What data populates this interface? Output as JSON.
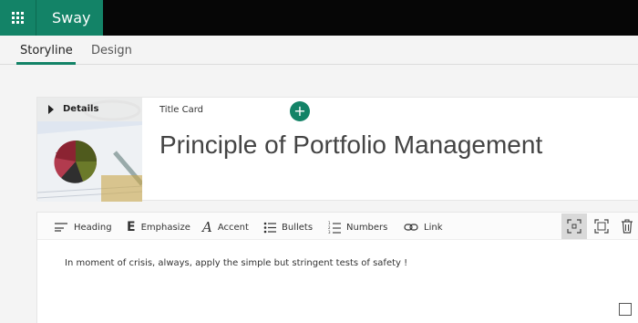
{
  "app": {
    "name": "Sway",
    "brand_color": "#138367"
  },
  "tabs": [
    {
      "label": "Storyline",
      "active": true
    },
    {
      "label": "Design",
      "active": false
    }
  ],
  "card": {
    "details_label": "Details",
    "type_label": "Title Card",
    "title": "Principle of Portfolio Management"
  },
  "toolbar": {
    "heading": "Heading",
    "emphasize": "Emphasize",
    "accent": "Accent",
    "bullets": "Bullets",
    "numbers": "Numbers",
    "link": "Link",
    "icons": [
      "focus-icon",
      "fullscreen-icon",
      "trash-icon"
    ]
  },
  "editor": {
    "text": "In moment of crisis, always, apply the simple but stringent tests of safety !"
  },
  "add_button": {
    "label": "+"
  }
}
